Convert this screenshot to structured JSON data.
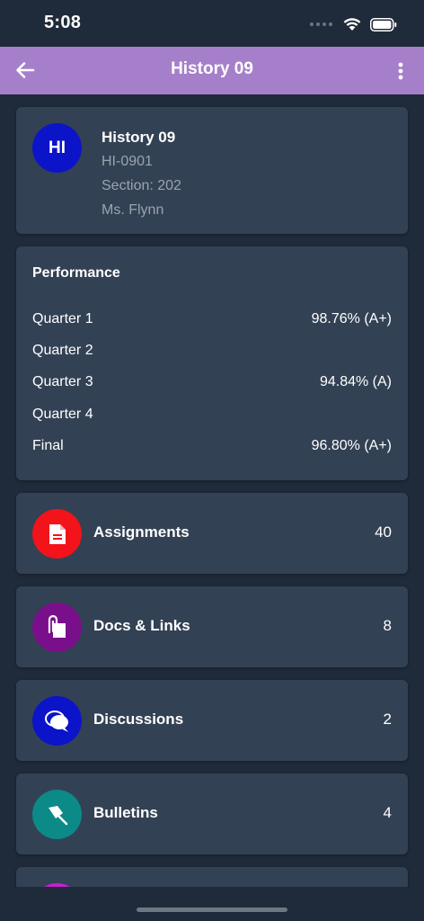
{
  "status_bar": {
    "time": "5:08"
  },
  "app_bar": {
    "title": "History 09"
  },
  "course": {
    "avatar_initials": "HI",
    "avatar_color": "#0b14c9",
    "title": "History 09",
    "code": "HI-0901",
    "section": "Section: 202",
    "teacher": "Ms. Flynn"
  },
  "performance": {
    "title": "Performance",
    "rows": [
      {
        "label": "Quarter 1",
        "value": "98.76% (A+)"
      },
      {
        "label": "Quarter 2",
        "value": ""
      },
      {
        "label": "Quarter 3",
        "value": "94.84% (A)"
      },
      {
        "label": "Quarter 4",
        "value": ""
      },
      {
        "label": "Final",
        "value": "96.80% (A+)"
      }
    ]
  },
  "nav_items": [
    {
      "label": "Assignments",
      "count": "40",
      "icon": "document-icon",
      "color": "#f2131b"
    },
    {
      "label": "Docs & Links",
      "count": "8",
      "icon": "paperclip-icon",
      "color": "#7a0f8c"
    },
    {
      "label": "Discussions",
      "count": "2",
      "icon": "chat-bubbles-icon",
      "color": "#0b14c9"
    },
    {
      "label": "Bulletins",
      "count": "4",
      "icon": "pushpin-icon",
      "color": "#0b8a87"
    }
  ],
  "partial_item": {
    "icon_color": "#c81fd1"
  },
  "colors": {
    "background": "#1f2a3a",
    "card": "#334154",
    "app_bar": "#a67fca"
  }
}
